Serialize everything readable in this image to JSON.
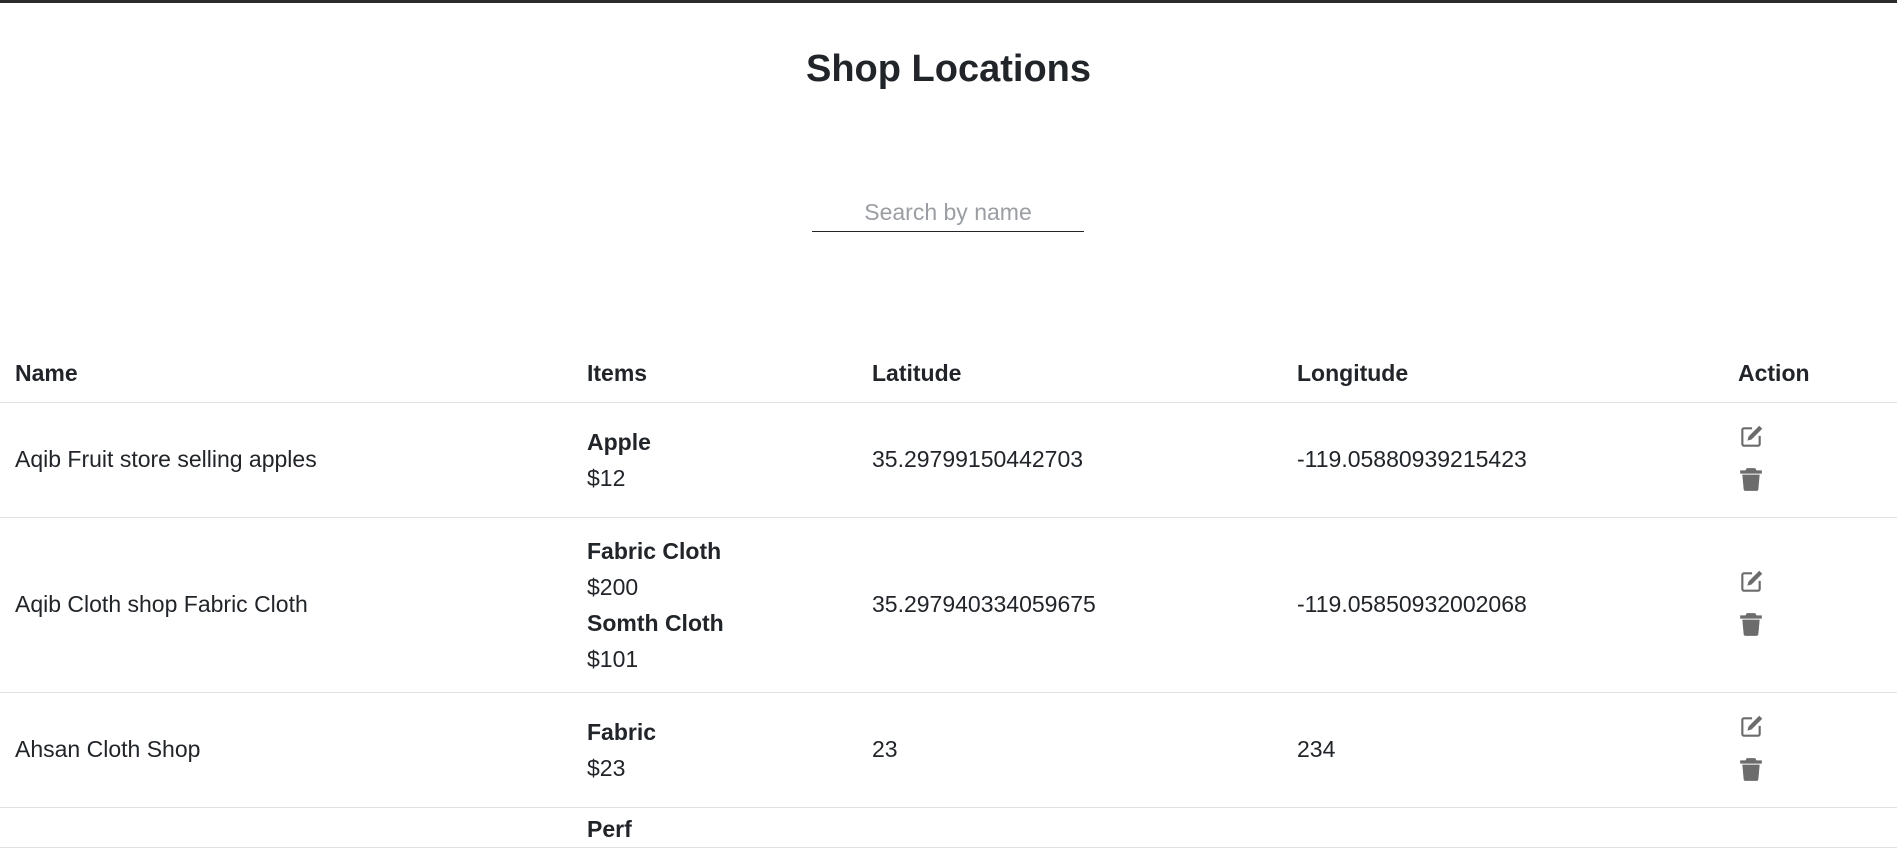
{
  "page": {
    "title": "Shop Locations"
  },
  "search": {
    "placeholder": "Search by name",
    "value": ""
  },
  "table": {
    "headers": {
      "name": "Name",
      "items": "Items",
      "latitude": "Latitude",
      "longitude": "Longitude",
      "action": "Action"
    },
    "rows": [
      {
        "name": "Aqib Fruit store selling apples",
        "items": [
          {
            "name": "Apple",
            "price": "$12"
          }
        ],
        "latitude": "35.29799150442703",
        "longitude": "-119.05880939215423"
      },
      {
        "name": "Aqib Cloth shop Fabric Cloth",
        "items": [
          {
            "name": "Fabric Cloth",
            "price": "$200"
          },
          {
            "name": "Somth Cloth",
            "price": "$101"
          }
        ],
        "latitude": "35.297940334059675",
        "longitude": "-119.05850932002068"
      },
      {
        "name": "Ahsan Cloth Shop",
        "items": [
          {
            "name": "Fabric",
            "price": "$23"
          }
        ],
        "latitude": "23",
        "longitude": "234"
      },
      {
        "name": "",
        "items": [
          {
            "name": "Perf",
            "price": ""
          }
        ],
        "latitude": "",
        "longitude": ""
      }
    ]
  },
  "icons": {
    "edit": "edit-icon",
    "delete": "trash-icon",
    "color": "#6c6c6c"
  }
}
